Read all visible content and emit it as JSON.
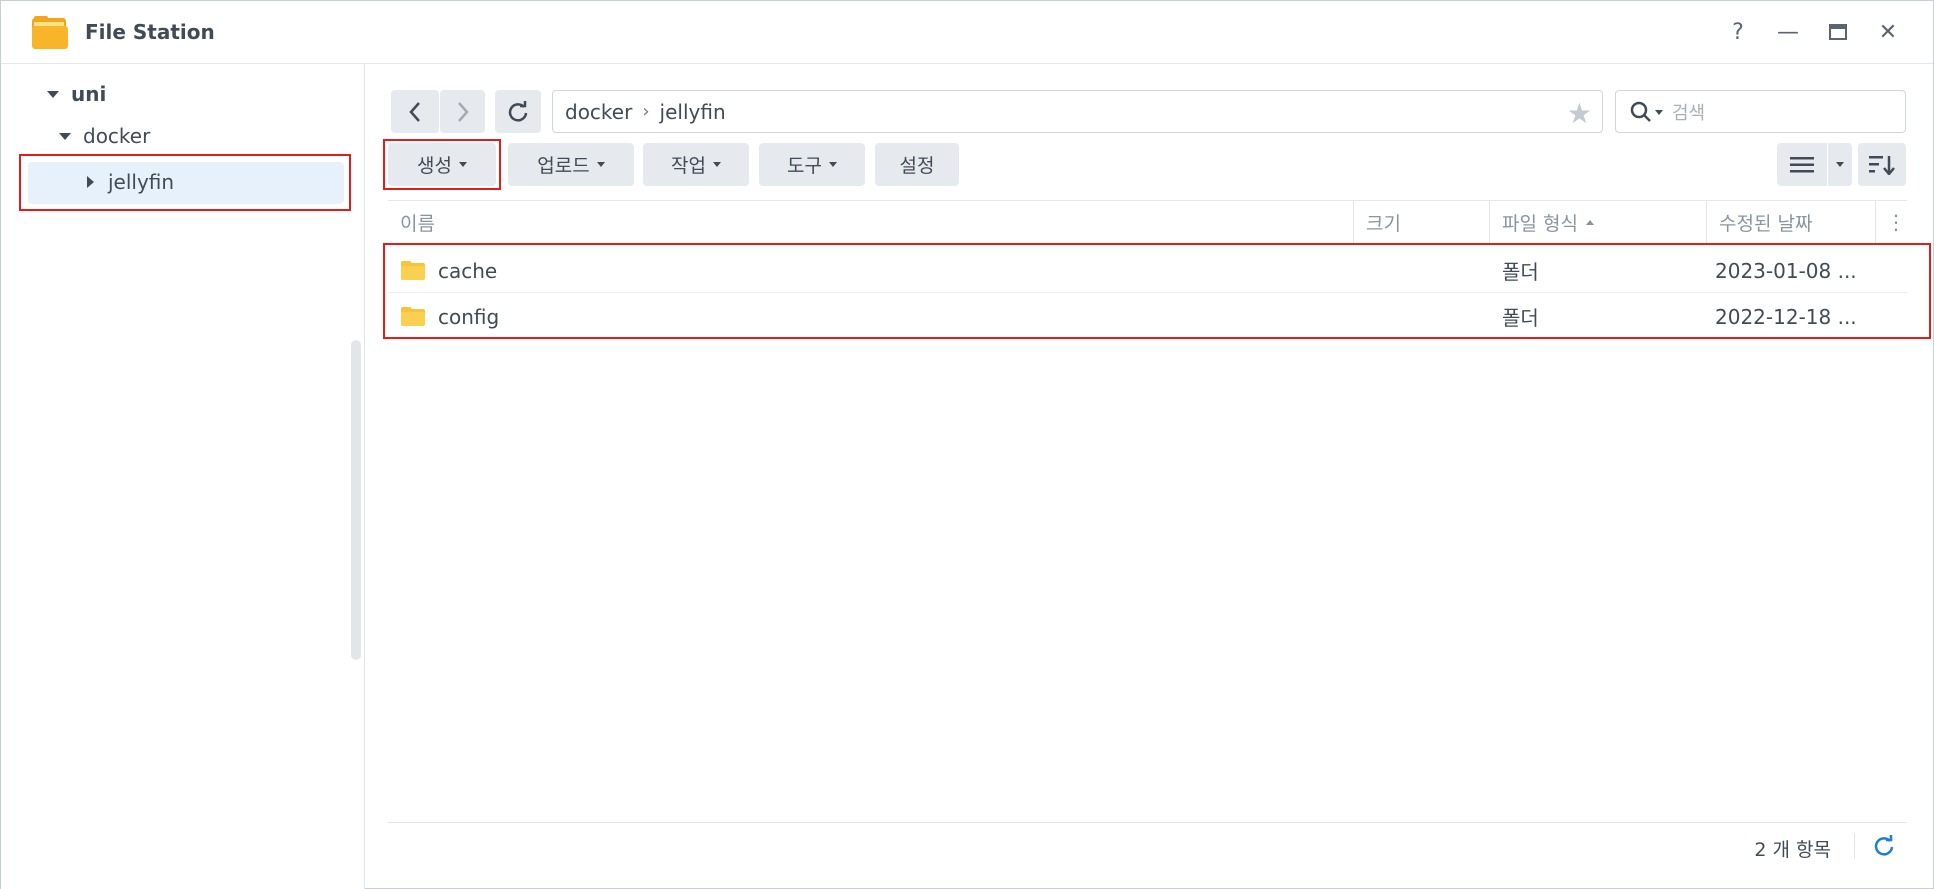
{
  "window": {
    "title": "File Station",
    "help": "?",
    "minimize": "—",
    "close": "✕"
  },
  "tree": {
    "root": "uni",
    "child": "docker",
    "selected": "jellyfin"
  },
  "path": {
    "segments": [
      "docker",
      "jellyfin"
    ],
    "separator": "›"
  },
  "search": {
    "placeholder": "검색"
  },
  "toolbar": {
    "create": "생성",
    "upload": "업로드",
    "action": "작업",
    "tools": "도구",
    "settings": "설정"
  },
  "table": {
    "columns": {
      "name": "이름",
      "size": "크기",
      "type": "파일 형식",
      "modified": "수정된 날짜"
    },
    "rows": [
      {
        "name": "cache",
        "size": "",
        "type": "폴더",
        "modified": "2023-01-08 ..."
      },
      {
        "name": "config",
        "size": "",
        "type": "폴더",
        "modified": "2022-12-18 ..."
      }
    ]
  },
  "footer": {
    "count": "2 개 항목"
  },
  "colors": {
    "accent": "#1b7fd6",
    "highlight_box": "#e21b1b",
    "folder": "#f7c33b",
    "selected_bg": "#e6f1fb"
  }
}
